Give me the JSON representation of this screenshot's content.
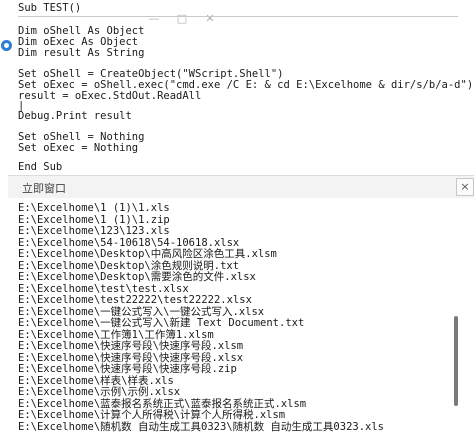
{
  "code_editor": {
    "lines": [
      "Sub TEST()",
      "Dim oShell As Object",
      "Dim oExec As Object",
      "Dim result As String",
      "Set oShell = CreateObject(\"WScript.Shell\")",
      "Set oExec = oShell.exec(\"cmd.exe /C E: & cd E:\\Excelhome & dir/s/b/a-d\")",
      "result = oExec.StdOut.ReadAll",
      "|",
      "Debug.Print result",
      "Set oShell = Nothing",
      "Set oExec = Nothing",
      "End Sub"
    ],
    "bg_window_controls": [
      "—",
      "□",
      "✕"
    ]
  },
  "immediate_window": {
    "title": "立即窗口",
    "close_label": "×",
    "output": [
      "E:\\Excelhome\\1 (1)\\1.xls",
      "E:\\Excelhome\\1 (1)\\1.zip",
      "E:\\Excelhome\\123\\123.xls",
      "E:\\Excelhome\\54-10618\\54-10618.xlsx",
      "E:\\Excelhome\\Desktop\\中高风险区涂色工具.xlsm",
      "E:\\Excelhome\\Desktop\\涂色规则说明.txt",
      "E:\\Excelhome\\Desktop\\需要涂色的文件.xlsx",
      "E:\\Excelhome\\test\\test.xlsx",
      "E:\\Excelhome\\test22222\\test22222.xlsx",
      "E:\\Excelhome\\一键公式写入\\一键公式写入.xlsx",
      "E:\\Excelhome\\一键公式写入\\新建 Text Document.txt",
      "E:\\Excelhome\\工作簿1\\工作簿1.xlsm",
      "E:\\Excelhome\\快速序号段\\快速序号段.xlsm",
      "E:\\Excelhome\\快速序号段\\快速序号段.xlsx",
      "E:\\Excelhome\\快速序号段\\快速序号段.zip",
      "E:\\Excelhome\\样表\\样表.xls",
      "E:\\Excelhome\\示例\\示例.xlsx",
      "E:\\Excelhome\\蓝泰报名系统正式\\蓝泰报名系统正式.xlsm",
      "E:\\Excelhome\\计算个人所得税\\计算个人所得税.xlsm",
      "E:\\Excelhome\\随机数 自动生成工具0323\\随机数 自动生成工具0323.xls"
    ]
  }
}
